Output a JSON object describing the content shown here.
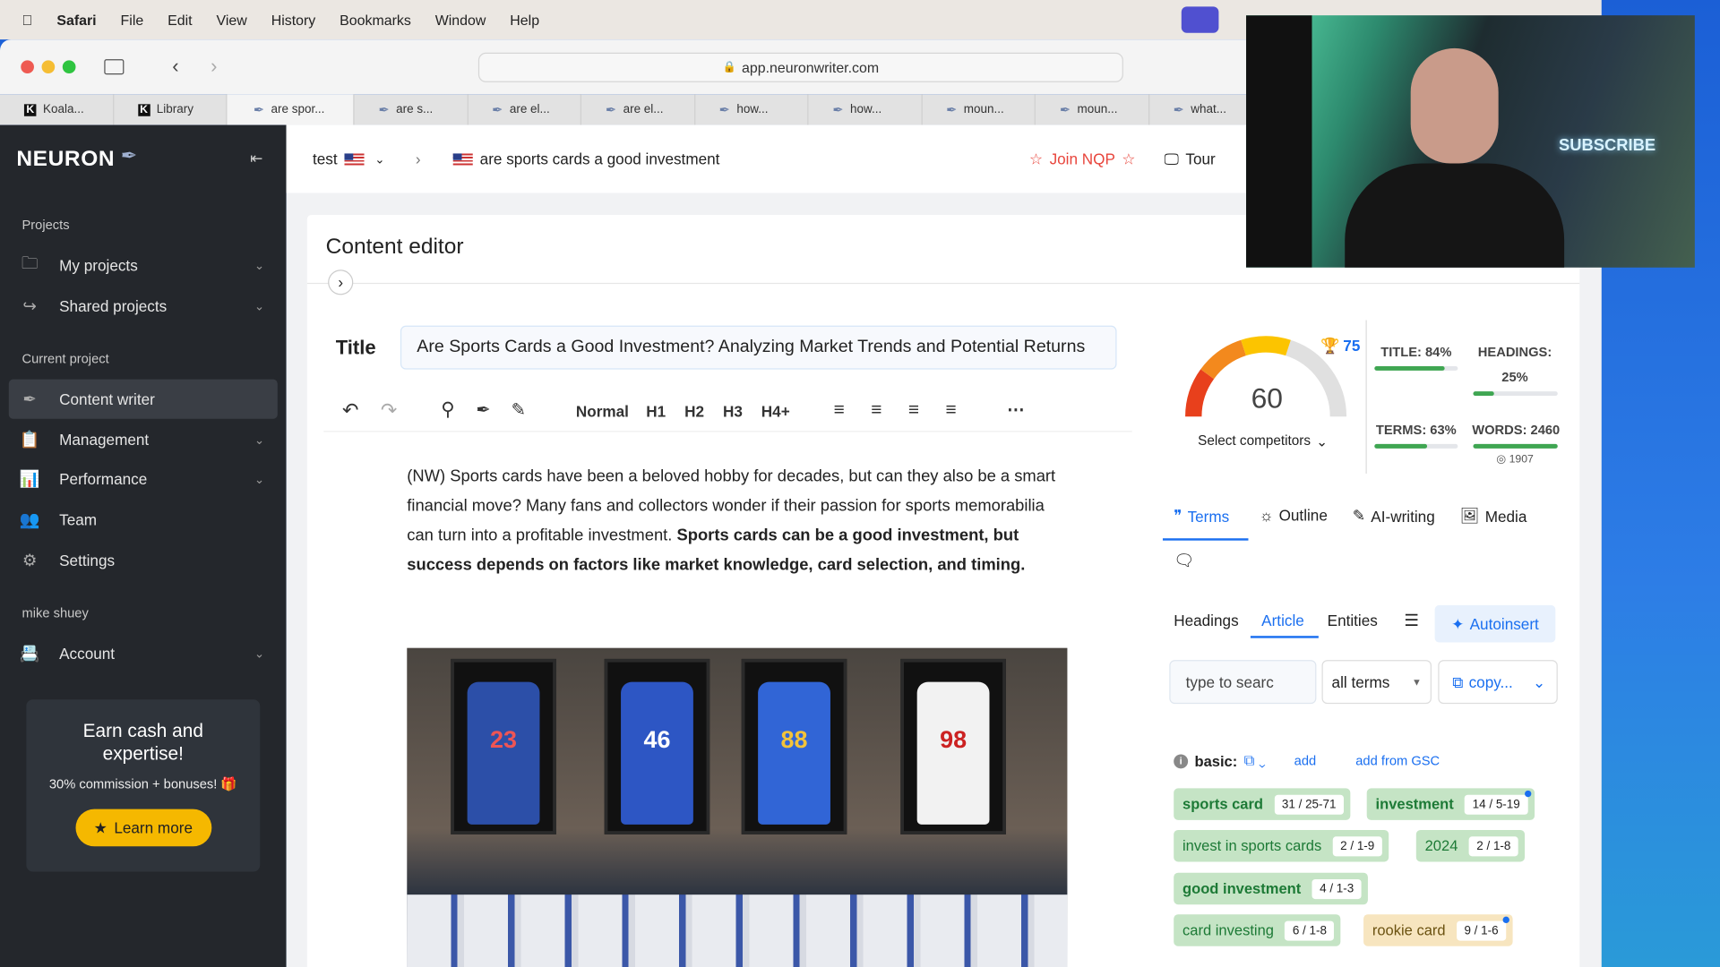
{
  "menubar": {
    "app": "Safari",
    "items": [
      "File",
      "Edit",
      "View",
      "History",
      "Bookmarks",
      "Window",
      "Help"
    ]
  },
  "browser": {
    "url": "app.neuronwriter.com",
    "tabs": [
      "Koala...",
      "Library",
      "are spor...",
      "are s...",
      "are el...",
      "are el...",
      "how...",
      "how...",
      "moun...",
      "moun...",
      "what..."
    ],
    "active_tab": 2
  },
  "sidebar": {
    "logo": "NEURON",
    "sections": {
      "projects": "Projects",
      "current": "Current project",
      "user": "mike shuey"
    },
    "items": [
      {
        "label": "My projects",
        "icon": "folder-icon"
      },
      {
        "label": "Shared projects",
        "icon": "share-folder-icon"
      },
      {
        "label": "Content writer",
        "icon": "feather-icon"
      },
      {
        "label": "Management",
        "icon": "clipboard-icon"
      },
      {
        "label": "Performance",
        "icon": "chart-icon"
      },
      {
        "label": "Team",
        "icon": "team-icon"
      },
      {
        "label": "Settings",
        "icon": "gear-icon"
      },
      {
        "label": "Account",
        "icon": "account-icon"
      }
    ],
    "promo": {
      "title": "Earn cash and expertise!",
      "subtitle": "30% commission + bonuses! 🎁",
      "button": "Learn more"
    }
  },
  "header": {
    "project": "test",
    "query": "are sports cards a good investment",
    "join": "Join NQP",
    "tour": "Tour"
  },
  "editor": {
    "heading": "Content editor",
    "title_label": "Title",
    "title_value": "Are Sports Cards a Good Investment? Analyzing Market Trends and Potential Returns",
    "formats": [
      "Normal",
      "H1",
      "H2",
      "H3",
      "H4+"
    ],
    "para_normal": "(NW) Sports cards have been a beloved hobby for decades, but can they also be a smart financial move? Many fans and collectors wonder if their passion for sports memorabilia can turn into a profitable investment. ",
    "para_bold": "Sports cards can be a good investment, but success depends on factors like market knowledge, card selection, and timing."
  },
  "score": {
    "value": 60,
    "target": 75,
    "max": 100,
    "select": "Select competitors",
    "title": "TITLE: 84%",
    "title_pct": 84,
    "headings": "HEADINGS:",
    "headings_val": "25%",
    "headings_pct": 25,
    "terms": "TERMS: 63%",
    "terms_pct": 63,
    "words": "WORDS: 2460",
    "words_pct": 100,
    "words_target": "1907"
  },
  "panel": {
    "tabs": [
      "Terms",
      "Outline",
      "AI-writing",
      "Media"
    ],
    "subtabs": [
      "Headings",
      "Article",
      "Entities"
    ],
    "autoinsert": "Autoinsert",
    "search_placeholder": "type to searc",
    "filter": "all terms",
    "copy": "copy...",
    "basic": "basic:",
    "add": "add",
    "add_gsc": "add from GSC",
    "terms": [
      {
        "t": "sports card",
        "c": "31 / 25-71"
      },
      {
        "t": "investment",
        "c": "14 / 5-19"
      },
      {
        "t": "invest in sports cards",
        "c": "2 / 1-9"
      },
      {
        "t": "2024",
        "c": "2 / 1-8"
      },
      {
        "t": "good investment",
        "c": "4 / 1-3"
      },
      {
        "t": "card investing",
        "c": "6 / 1-8"
      },
      {
        "t": "rookie card",
        "c": "9 / 1-6"
      }
    ]
  },
  "webcam": {
    "sign": "SUBSCRIBE"
  },
  "colors": {
    "accent": "#1a6ff0",
    "join": "#e8453c",
    "chip_green": "#c5e4c5",
    "chip_amber": "#f7e5bf"
  }
}
